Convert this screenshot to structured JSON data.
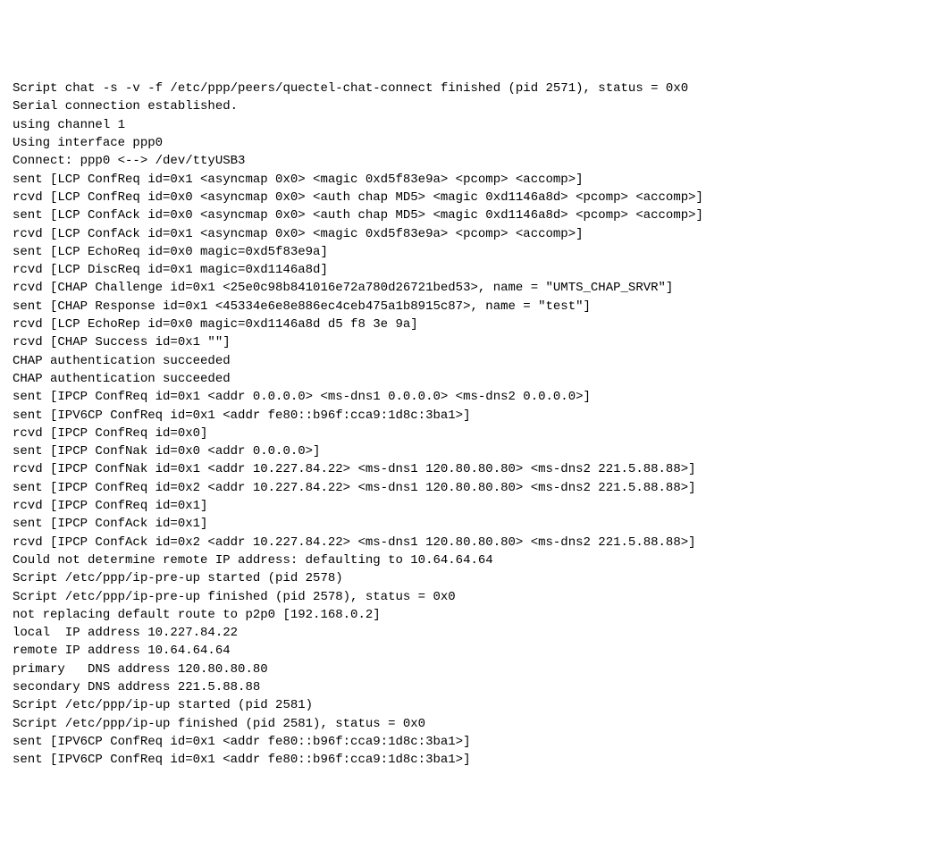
{
  "lines": [
    "Script chat -s -v -f /etc/ppp/peers/quectel-chat-connect finished (pid 2571), status = 0x0",
    "Serial connection established.",
    "using channel 1",
    "Using interface ppp0",
    "Connect: ppp0 <--> /dev/ttyUSB3",
    "sent [LCP ConfReq id=0x1 <asyncmap 0x0> <magic 0xd5f83e9a> <pcomp> <accomp>]",
    "rcvd [LCP ConfReq id=0x0 <asyncmap 0x0> <auth chap MD5> <magic 0xd1146a8d> <pcomp> <accomp>]",
    "sent [LCP ConfAck id=0x0 <asyncmap 0x0> <auth chap MD5> <magic 0xd1146a8d> <pcomp> <accomp>]",
    "rcvd [LCP ConfAck id=0x1 <asyncmap 0x0> <magic 0xd5f83e9a> <pcomp> <accomp>]",
    "sent [LCP EchoReq id=0x0 magic=0xd5f83e9a]",
    "rcvd [LCP DiscReq id=0x1 magic=0xd1146a8d]",
    "rcvd [CHAP Challenge id=0x1 <25e0c98b841016e72a780d26721bed53>, name = \"UMTS_CHAP_SRVR\"]",
    "sent [CHAP Response id=0x1 <45334e6e8e886ec4ceb475a1b8915c87>, name = \"test\"]",
    "rcvd [LCP EchoRep id=0x0 magic=0xd1146a8d d5 f8 3e 9a]",
    "rcvd [CHAP Success id=0x1 \"\"]",
    "CHAP authentication succeeded",
    "CHAP authentication succeeded",
    "sent [IPCP ConfReq id=0x1 <addr 0.0.0.0> <ms-dns1 0.0.0.0> <ms-dns2 0.0.0.0>]",
    "sent [IPV6CP ConfReq id=0x1 <addr fe80::b96f:cca9:1d8c:3ba1>]",
    "rcvd [IPCP ConfReq id=0x0]",
    "sent [IPCP ConfNak id=0x0 <addr 0.0.0.0>]",
    "rcvd [IPCP ConfNak id=0x1 <addr 10.227.84.22> <ms-dns1 120.80.80.80> <ms-dns2 221.5.88.88>]",
    "sent [IPCP ConfReq id=0x2 <addr 10.227.84.22> <ms-dns1 120.80.80.80> <ms-dns2 221.5.88.88>]",
    "rcvd [IPCP ConfReq id=0x1]",
    "sent [IPCP ConfAck id=0x1]",
    "rcvd [IPCP ConfAck id=0x2 <addr 10.227.84.22> <ms-dns1 120.80.80.80> <ms-dns2 221.5.88.88>]",
    "Could not determine remote IP address: defaulting to 10.64.64.64",
    "Script /etc/ppp/ip-pre-up started (pid 2578)",
    "Script /etc/ppp/ip-pre-up finished (pid 2578), status = 0x0",
    "not replacing default route to p2p0 [192.168.0.2]",
    "local  IP address 10.227.84.22",
    "remote IP address 10.64.64.64",
    "primary   DNS address 120.80.80.80",
    "secondary DNS address 221.5.88.88",
    "Script /etc/ppp/ip-up started (pid 2581)",
    "Script /etc/ppp/ip-up finished (pid 2581), status = 0x0",
    "sent [IPV6CP ConfReq id=0x1 <addr fe80::b96f:cca9:1d8c:3ba1>]",
    "sent [IPV6CP ConfReq id=0x1 <addr fe80::b96f:cca9:1d8c:3ba1>]"
  ]
}
